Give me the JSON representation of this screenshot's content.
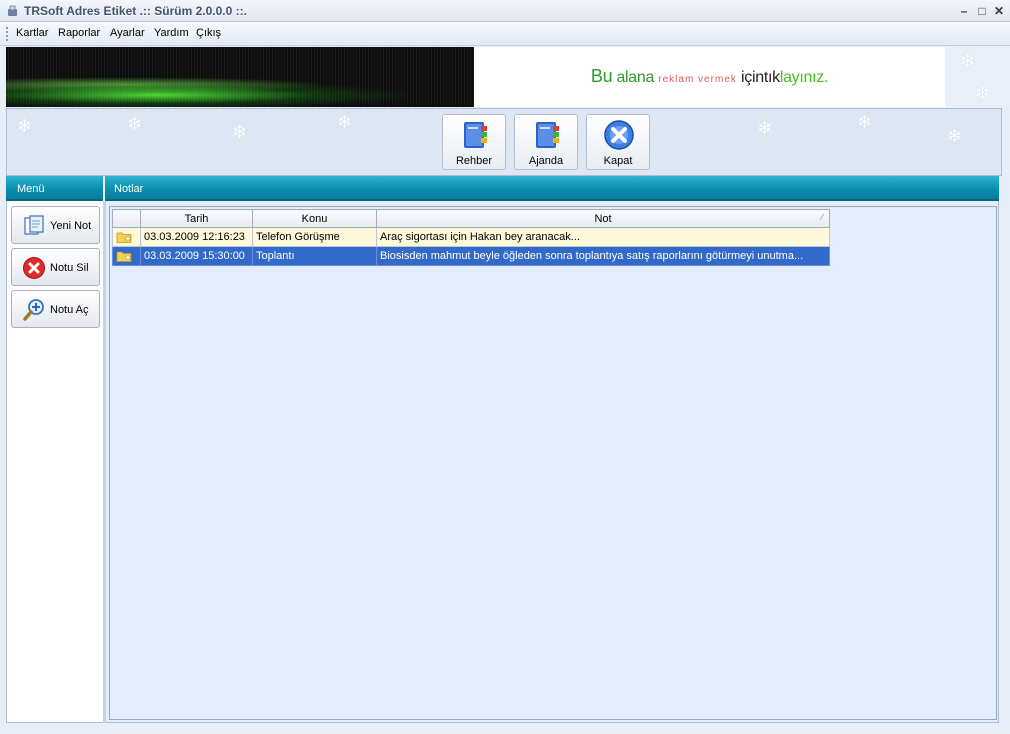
{
  "window": {
    "title": "TRSoft Adres Etiket  .:: Sürüm 2.0.0.0 ::.",
    "icon": "app-icon",
    "controls": [
      "minimize",
      "maximize",
      "close"
    ]
  },
  "menu": {
    "items": [
      "Kartlar",
      "Raporlar",
      "Ayarlar",
      "Yardım",
      "Çıkış"
    ]
  },
  "banner": {
    "ad_part1": "Bu",
    "ad_part2": "alana",
    "ad_part3": "reklam vermek",
    "ad_part4": "için",
    "ad_part5": "tık",
    "ad_part6": "layınız."
  },
  "toolbar": {
    "buttons": [
      {
        "label": "Rehber",
        "icon": "address-book-icon"
      },
      {
        "label": "Ajanda",
        "icon": "agenda-icon"
      },
      {
        "label": "Kapat",
        "icon": "close-circle-icon"
      }
    ]
  },
  "sections": {
    "left_title": "Menü",
    "right_title": "Notlar"
  },
  "side_menu": {
    "buttons": [
      {
        "label": "Yeni Not",
        "icon": "new-note-icon"
      },
      {
        "label": "Notu Sil",
        "icon": "delete-icon"
      },
      {
        "label": "Notu Aç",
        "icon": "open-magnifier-icon"
      }
    ]
  },
  "notes_table": {
    "columns": [
      "Tarih",
      "Konu",
      "Not"
    ],
    "rows": [
      {
        "tarih": "03.03.2009 12:16:23",
        "konu": "Telefon Görüşme",
        "not": "Araç sigortası için Hakan bey aranacak...",
        "selected": false
      },
      {
        "tarih": "03.03.2009 15:30:00",
        "konu": "Toplantı",
        "not": "Biosisden mahmut beyle öğleden sonra toplantıya satış raporlarını götürmeyi unutma...",
        "selected": true
      }
    ]
  },
  "colors": {
    "section_bar": "#0b8fb0",
    "selected_row": "#3369c9",
    "row_background": "#fff9dc",
    "panel_background": "#e4edfb"
  }
}
